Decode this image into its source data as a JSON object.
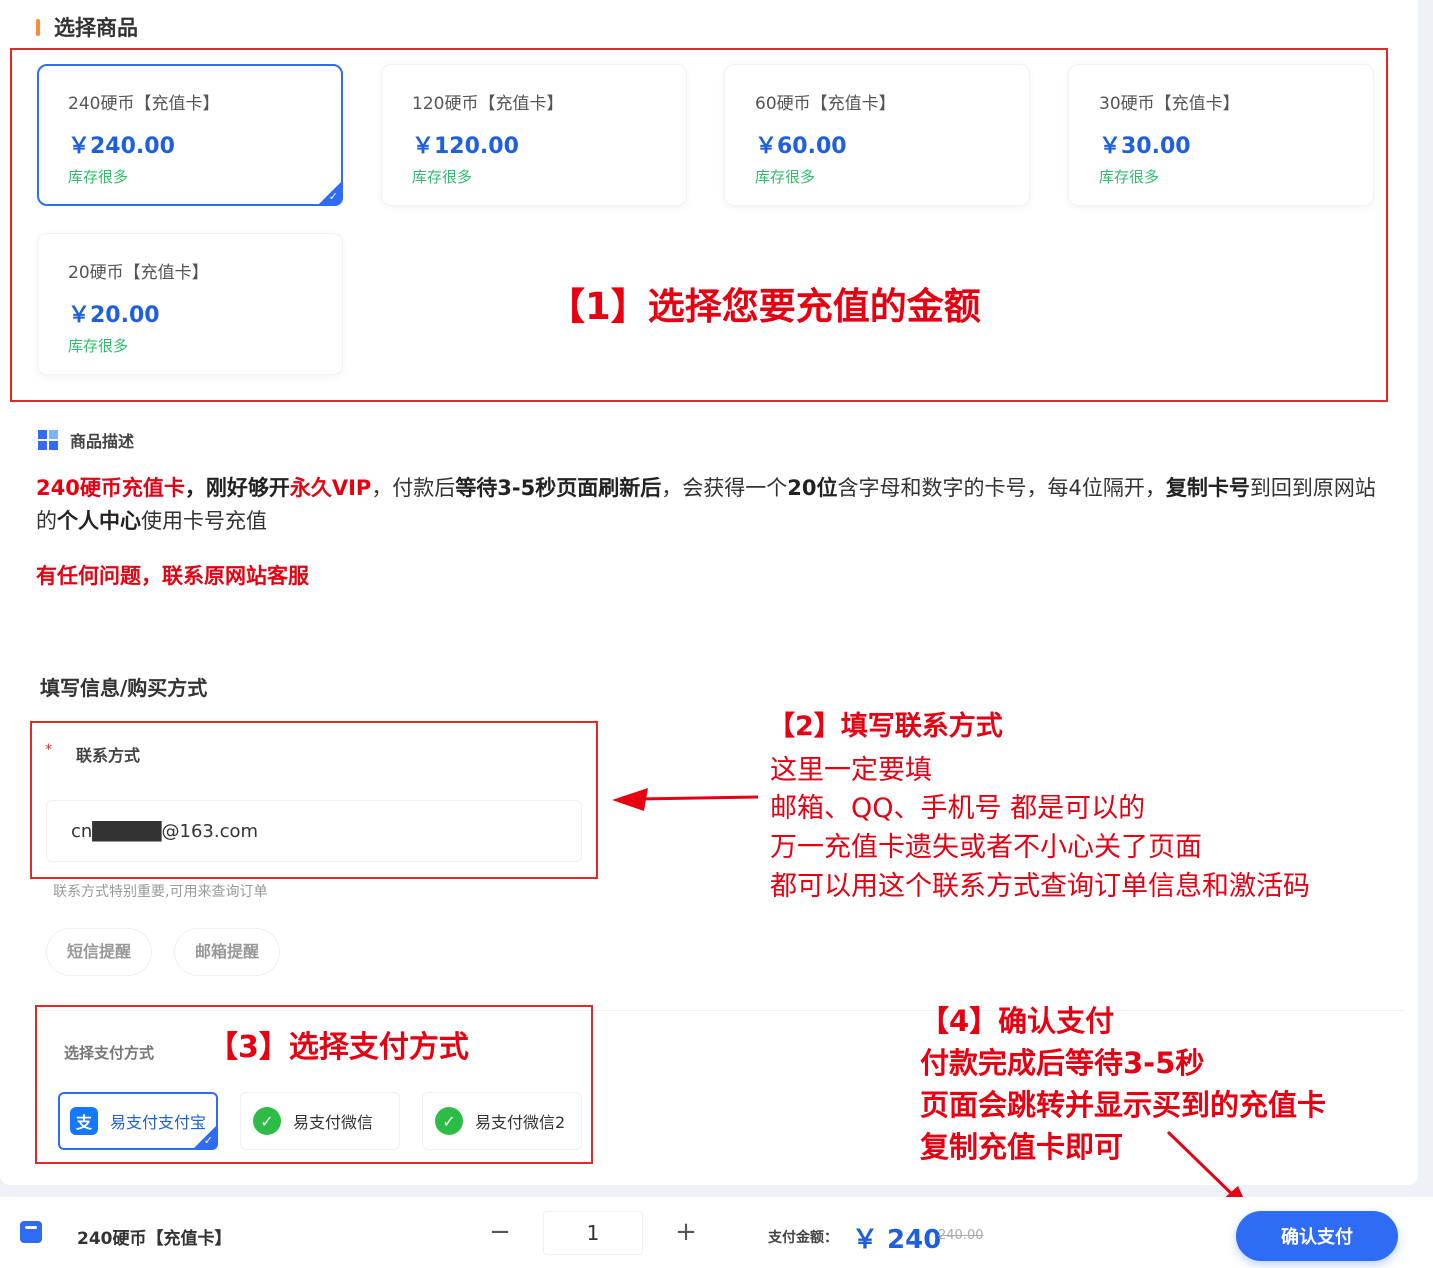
{
  "section": {
    "title": "选择商品"
  },
  "products": [
    {
      "name": "240硬币【充值卡】",
      "price": "￥240.00",
      "stock": "库存很多",
      "selected": true
    },
    {
      "name": "120硬币【充值卡】",
      "price": "￥120.00",
      "stock": "库存很多",
      "selected": false
    },
    {
      "name": "60硬币【充值卡】",
      "price": "￥60.00",
      "stock": "库存很多",
      "selected": false
    },
    {
      "name": "30硬币【充值卡】",
      "price": "￥30.00",
      "stock": "库存很多",
      "selected": false
    },
    {
      "name": "20硬币【充值卡】",
      "price": "￥20.00",
      "stock": "库存很多",
      "selected": false
    }
  ],
  "annotations": {
    "step1": "【1】选择您要充值的金额",
    "step2": {
      "title": "【2】填写联系方式",
      "lines": [
        "这里一定要填",
        "邮箱、QQ、手机号 都是可以的",
        "万一充值卡遗失或者不小心关了页面",
        "都可以用这个联系方式查询订单信息和激活码"
      ]
    },
    "step3": "【3】选择支付方式",
    "step4": {
      "title": "【4】确认支付",
      "lines": [
        "付款完成后等待3-5秒",
        "页面会跳转并显示买到的充值卡",
        "复制充值卡即可"
      ]
    }
  },
  "description": {
    "heading": "商品描述",
    "p1": [
      "240硬币充值卡",
      "，",
      "刚好够开",
      "永久VIP",
      "，付款后",
      "等待3-5秒页面刷新后",
      "，会获得一个",
      "20位",
      "含字母和数字的卡号，每4位隔开，",
      "复制卡号",
      "到回到原网站的",
      "个人中心",
      "使用卡号充值"
    ],
    "p2": "有任何问题，联系原网站客服"
  },
  "form": {
    "title": "填写信息/购买方式",
    "contact_label": "联系方式",
    "required_mark": "*",
    "contact_value": "cn█████@163.com",
    "contact_hint": "联系方式特别重要,可用来查询订单",
    "notify_sms": "短信提醒",
    "notify_email": "邮箱提醒"
  },
  "payment": {
    "label": "选择支付方式",
    "options": [
      {
        "label": "易支付支付宝",
        "icon": "alipay-icon",
        "glyph": "支",
        "selected": true
      },
      {
        "label": "易支付微信",
        "icon": "wechat-icon",
        "glyph": "✓",
        "selected": false
      },
      {
        "label": "易支付微信2",
        "icon": "wechat-icon",
        "glyph": "✓",
        "selected": false
      }
    ]
  },
  "footer": {
    "product_name": "240硬币【充值卡】",
    "minus": "−",
    "plus": "+",
    "quantity": "1",
    "amount_label": "支付金额：",
    "amount": "￥ 240",
    "original": "240.00",
    "confirm": "确认支付"
  },
  "colors": {
    "accent": "#2f6cf6",
    "annotation_red": "#e60012",
    "stock_green": "#2dbd6b"
  }
}
